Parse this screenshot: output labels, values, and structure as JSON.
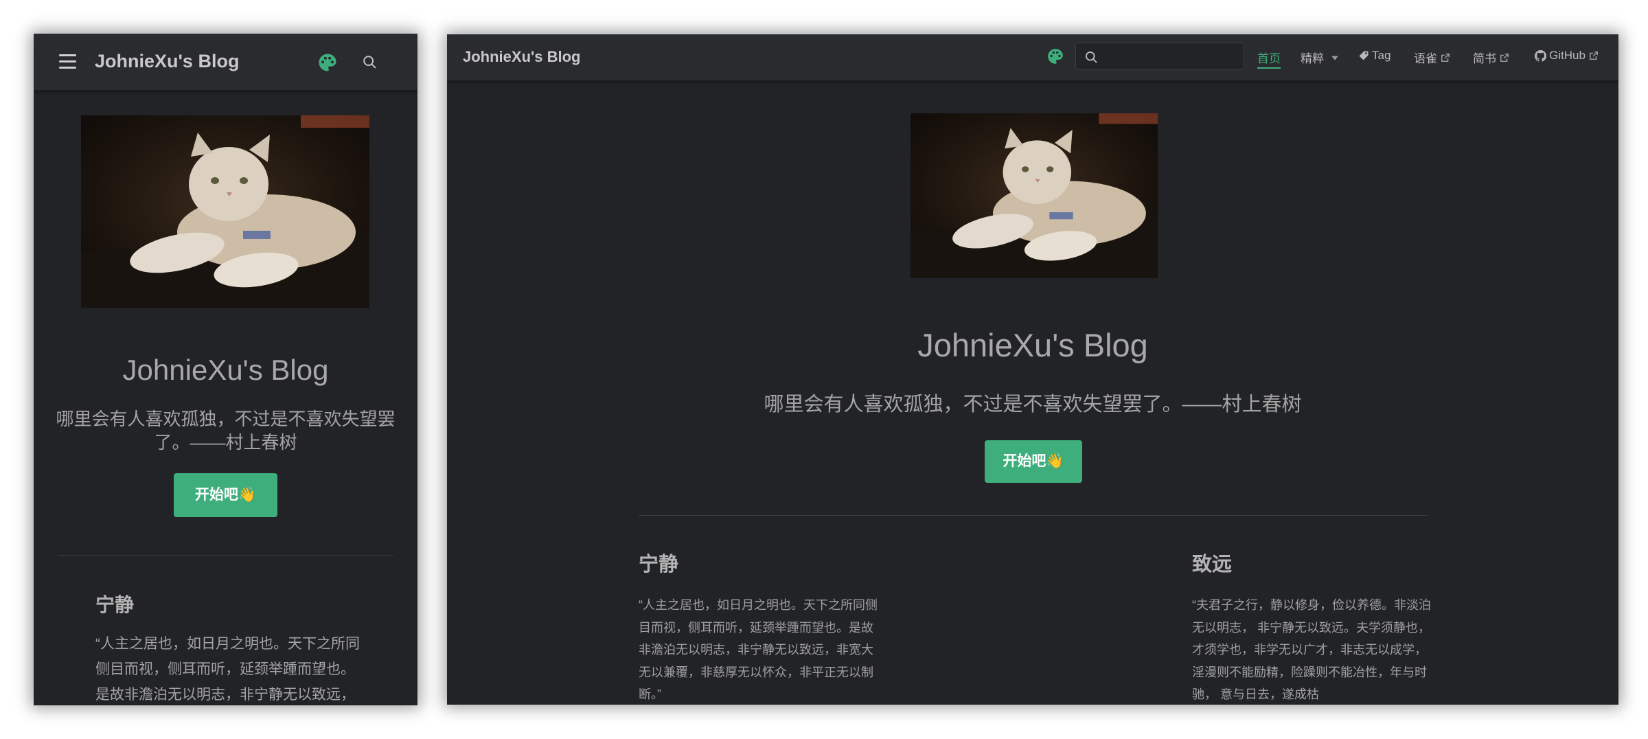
{
  "site": {
    "title": "JohnieXu's Blog",
    "tagline": "哪里会有人喜欢孤独，不过是不喜欢失望罢了。——村上春树",
    "cta_label": "开始吧👋"
  },
  "nav": {
    "items": [
      {
        "label": "首页",
        "active": true
      },
      {
        "label": "精粹",
        "dropdown": true
      },
      {
        "label": "Tag",
        "icon": "tag-icon"
      },
      {
        "label": "语雀",
        "external": true
      },
      {
        "label": "简书",
        "external": true
      },
      {
        "label": "GitHub",
        "icon": "github-icon",
        "external": true
      }
    ],
    "search_value": ""
  },
  "features": [
    {
      "title": "宁静",
      "text": "“人主之居也，如日月之明也。天下之所同侧目而视，侧耳而听，延颈举踵而望也。是故非澹泊无以明志，非宁静无以致远，非宽大无以兼覆，非慈厚无以怀众，非平正无以制断。”"
    },
    {
      "title": "致远",
      "text": "“夫君子之行，静以修身，俭以养德。非淡泊无以明志， 非宁静无以致远。夫学须静也，才须学也，非学无以广才，非志无以成学，淫漫则不能励精，险躁则不能冶性，年与时驰， 意与日去，遂成枯"
    }
  ],
  "icons": {
    "menu": "hamburger-menu-icon",
    "theme": "palette-icon",
    "search": "search-icon",
    "hero": "cat-photo"
  },
  "colors": {
    "accent": "#3eaf7c",
    "background": "#222326",
    "navbar": "#2a2b2e",
    "text": "#a9a9a9"
  }
}
